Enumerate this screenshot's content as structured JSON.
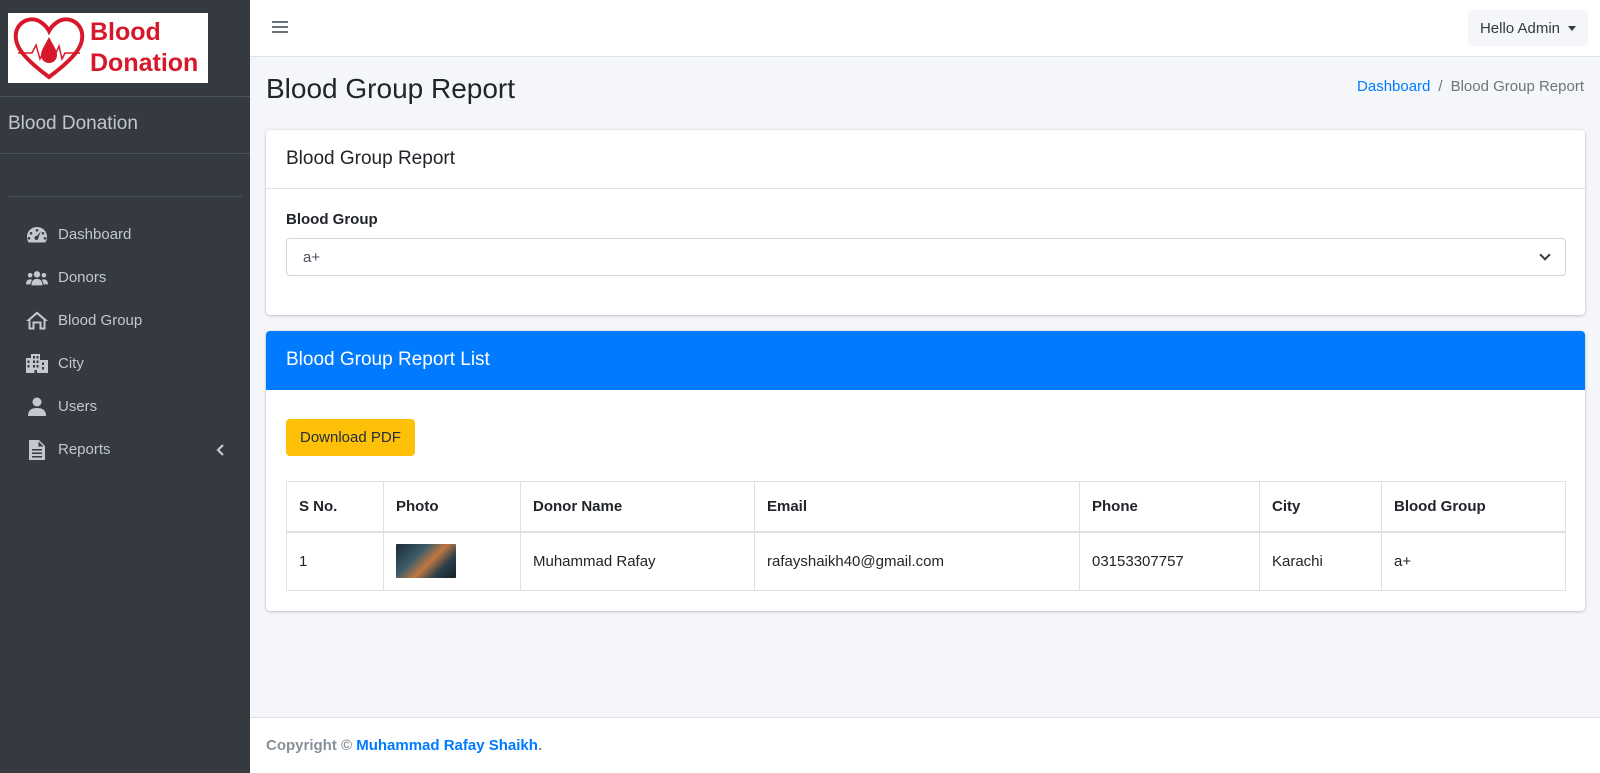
{
  "brand": {
    "logo_line1": "Blood",
    "logo_line2": "Donation",
    "sidebar_title": "Blood Donation"
  },
  "sidebar": {
    "items": [
      {
        "label": "Dashboard",
        "icon": "tachometer-icon"
      },
      {
        "label": "Donors",
        "icon": "users-icon"
      },
      {
        "label": "Blood Group",
        "icon": "home-icon"
      },
      {
        "label": "City",
        "icon": "building-icon"
      },
      {
        "label": "Users",
        "icon": "user-icon"
      },
      {
        "label": "Reports",
        "icon": "file-icon"
      }
    ]
  },
  "navbar": {
    "user_menu": "Hello Admin"
  },
  "header": {
    "title": "Blood Group Report",
    "breadcrumb": [
      "Dashboard",
      "Blood Group Report"
    ]
  },
  "filter_card": {
    "title": "Blood Group Report",
    "label": "Blood Group",
    "selected": "a+"
  },
  "list_card": {
    "title": "Blood Group Report List",
    "download_label": "Download PDF",
    "columns": [
      "S No.",
      "Photo",
      "Donor Name",
      "Email",
      "Phone",
      "City",
      "Blood Group"
    ],
    "rows": [
      {
        "sno": "1",
        "donor_name": "Muhammad Rafay",
        "email": "rafayshaikh40@gmail.com",
        "phone": "03153307757",
        "city": "Karachi",
        "blood_group": "a+"
      }
    ]
  },
  "footer": {
    "prefix": "Copyright © ",
    "author": "Muhammad Rafay Shaikh",
    "suffix": "."
  },
  "colors": {
    "sidebar_bg": "#343a40",
    "primary": "#007bff",
    "warning": "#ffc107",
    "logo_red": "#d7182a"
  }
}
